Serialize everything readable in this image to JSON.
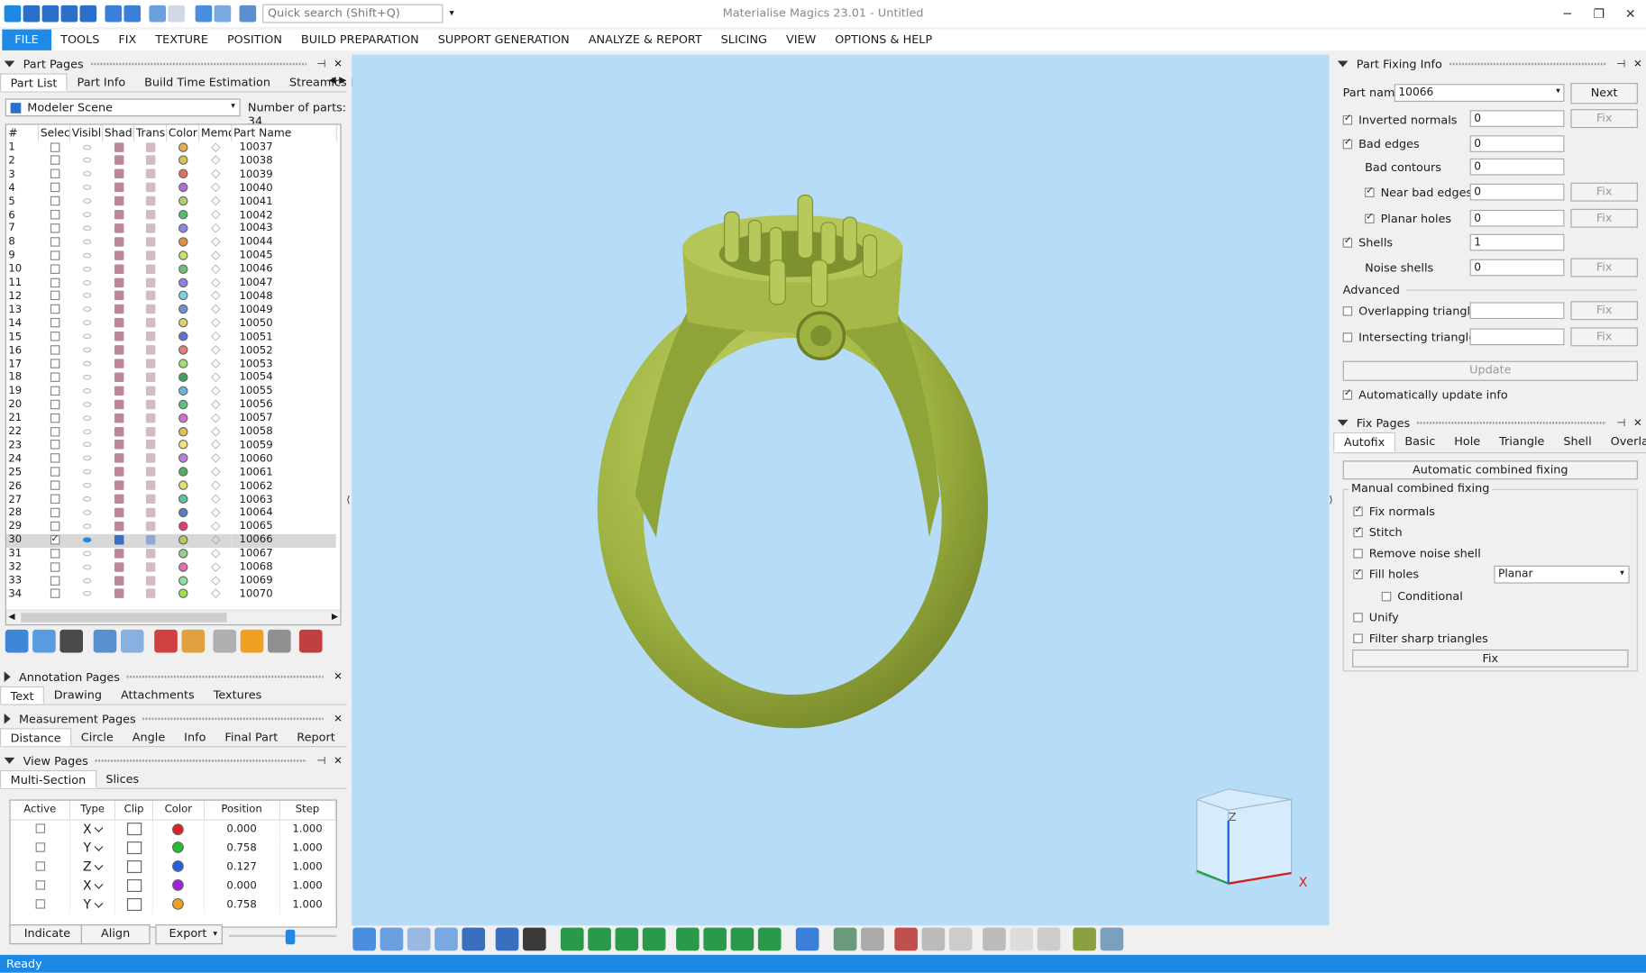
{
  "window": {
    "title": "Materialise Magics 23.01 - Untitled",
    "quick_search_placeholder": "Quick search (Shift+Q)"
  },
  "menu": [
    "FILE",
    "TOOLS",
    "FIX",
    "TEXTURE",
    "POSITION",
    "BUILD PREPARATION",
    "SUPPORT GENERATION",
    "ANALYZE & REPORT",
    "SLICING",
    "VIEW",
    "OPTIONS & HELP"
  ],
  "part_pages": {
    "title": "Part Pages",
    "tabs": [
      "Part List",
      "Part Info",
      "Build Time Estimation",
      "Streamics Part"
    ],
    "scene": "Modeler Scene",
    "number_label": "Number of parts:",
    "number_value": "34",
    "columns": [
      "#",
      "Select",
      "Visibl",
      "Shadi",
      "Trans",
      "Color",
      "Memo",
      "Part Name"
    ],
    "rows": [
      {
        "n": "1",
        "name": "10037",
        "color": "#e6b04a"
      },
      {
        "n": "2",
        "name": "10038",
        "color": "#d6c45a"
      },
      {
        "n": "3",
        "name": "10039",
        "color": "#e07060"
      },
      {
        "n": "4",
        "name": "10040",
        "color": "#b070d0"
      },
      {
        "n": "5",
        "name": "10041",
        "color": "#b0d070"
      },
      {
        "n": "6",
        "name": "10042",
        "color": "#50c070"
      },
      {
        "n": "7",
        "name": "10043",
        "color": "#8a8ae0"
      },
      {
        "n": "8",
        "name": "10044",
        "color": "#e09040"
      },
      {
        "n": "9",
        "name": "10045",
        "color": "#c8e070"
      },
      {
        "n": "10",
        "name": "10046",
        "color": "#70c070"
      },
      {
        "n": "11",
        "name": "10047",
        "color": "#9080e0"
      },
      {
        "n": "12",
        "name": "10048",
        "color": "#80d0e0"
      },
      {
        "n": "13",
        "name": "10049",
        "color": "#7090d0"
      },
      {
        "n": "14",
        "name": "10050",
        "color": "#e0d070"
      },
      {
        "n": "15",
        "name": "10051",
        "color": "#6070d0"
      },
      {
        "n": "16",
        "name": "10052",
        "color": "#e08070"
      },
      {
        "n": "17",
        "name": "10053",
        "color": "#a0e070"
      },
      {
        "n": "18",
        "name": "10054",
        "color": "#40a060"
      },
      {
        "n": "19",
        "name": "10055",
        "color": "#70b0e0"
      },
      {
        "n": "20",
        "name": "10056",
        "color": "#60c080"
      },
      {
        "n": "21",
        "name": "10057",
        "color": "#d070d0"
      },
      {
        "n": "22",
        "name": "10058",
        "color": "#e0c050"
      },
      {
        "n": "23",
        "name": "10059",
        "color": "#f0e080"
      },
      {
        "n": "24",
        "name": "10060",
        "color": "#c080e0"
      },
      {
        "n": "25",
        "name": "10061",
        "color": "#50b060"
      },
      {
        "n": "26",
        "name": "10062",
        "color": "#e0e070"
      },
      {
        "n": "27",
        "name": "10063",
        "color": "#60c0a0"
      },
      {
        "n": "28",
        "name": "10064",
        "color": "#5080c0"
      },
      {
        "n": "29",
        "name": "10065",
        "color": "#e04070"
      },
      {
        "n": "30",
        "name": "10066",
        "color": "#b8c860",
        "selected": true
      },
      {
        "n": "31",
        "name": "10067",
        "color": "#90d090"
      },
      {
        "n": "32",
        "name": "10068",
        "color": "#e070b0"
      },
      {
        "n": "33",
        "name": "10069",
        "color": "#90e0a0"
      },
      {
        "n": "34",
        "name": "10070",
        "color": "#a0e050"
      }
    ]
  },
  "annotation": {
    "title": "Annotation Pages",
    "tabs": [
      "Text",
      "Drawing",
      "Attachments",
      "Textures"
    ]
  },
  "measurement": {
    "title": "Measurement Pages",
    "tabs": [
      "Distance",
      "Circle",
      "Angle",
      "Info",
      "Final Part",
      "Report"
    ]
  },
  "viewpages": {
    "title": "View Pages",
    "tabs": [
      "Multi-Section",
      "Slices"
    ],
    "columns": [
      "Active",
      "Type",
      "Clip",
      "Color",
      "Position",
      "Step"
    ],
    "rows": [
      {
        "type": "X",
        "color": "#e02020",
        "pos": "0.000",
        "step": "1.000"
      },
      {
        "type": "Y",
        "color": "#20c030",
        "pos": "0.758",
        "step": "1.000"
      },
      {
        "type": "Z",
        "color": "#2060e0",
        "pos": "0.127",
        "step": "1.000"
      },
      {
        "type": "X",
        "color": "#a020e0",
        "pos": "0.000",
        "step": "1.000"
      },
      {
        "type": "Y",
        "color": "#f0a020",
        "pos": "0.758",
        "step": "1.000"
      }
    ],
    "buttons": [
      "Indicate",
      "Align",
      "Export"
    ]
  },
  "fixing_info": {
    "title": "Part Fixing Info",
    "part_name_label": "Part name",
    "part_name": "10066",
    "next": "Next",
    "fix": "Fix",
    "inverted_normals": {
      "label": "Inverted normals",
      "value": "0"
    },
    "bad_edges": {
      "label": "Bad edges",
      "value": "0"
    },
    "bad_contours": {
      "label": "Bad contours",
      "value": "0"
    },
    "near_bad_edges": {
      "label": "Near bad edges",
      "value": "0"
    },
    "planar_holes": {
      "label": "Planar holes",
      "value": "0"
    },
    "shells": {
      "label": "Shells",
      "value": "1"
    },
    "noise_shells": {
      "label": "Noise shells",
      "value": "0"
    },
    "advanced": "Advanced",
    "overlapping": "Overlapping triangles",
    "intersecting": "Intersecting triangles",
    "update": "Update",
    "auto_update": "Automatically update info"
  },
  "fix_pages": {
    "title": "Fix Pages",
    "tabs": [
      "Autofix",
      "Basic",
      "Hole",
      "Triangle",
      "Shell",
      "Overla"
    ],
    "auto_combined": "Automatic combined fixing",
    "manual_group": "Manual combined fixing",
    "fix_normals": "Fix normals",
    "stitch": "Stitch",
    "remove_noise": "Remove noise shell",
    "fill_holes": "Fill holes",
    "fill_mode": "Planar",
    "conditional": "Conditional",
    "unify": "Unify",
    "filter_sharp": "Filter sharp triangles",
    "fix": "Fix"
  },
  "status": "Ready",
  "ring_color": "#9db240"
}
